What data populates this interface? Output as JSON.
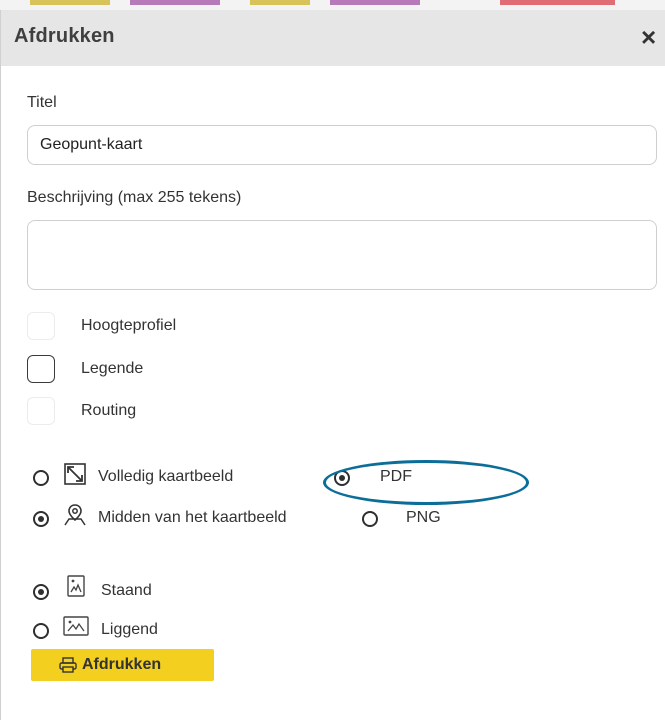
{
  "dialog": {
    "title": "Afdrukken",
    "close_glyph": "×"
  },
  "form": {
    "title_label": "Titel",
    "title_value": "Geopunt-kaart",
    "description_label": "Beschrijving (max 255 tekens)",
    "description_value": ""
  },
  "checkboxes": [
    {
      "label": "Hoogteprofiel",
      "checked": false
    },
    {
      "label": "Legende",
      "checked": false
    },
    {
      "label": "Routing",
      "checked": false
    }
  ],
  "extent_options": [
    {
      "label": "Volledig kaartbeeld",
      "icon": "full-extent-icon",
      "selected": false
    },
    {
      "label": "Midden van het kaartbeeld",
      "icon": "map-pin-icon",
      "selected": true
    }
  ],
  "format_options": [
    {
      "label": "PDF",
      "selected": true
    },
    {
      "label": "PNG",
      "selected": false
    }
  ],
  "orientation_options": [
    {
      "label": "Staand",
      "icon": "portrait-image-icon",
      "selected": true
    },
    {
      "label": "Liggend",
      "icon": "landscape-image-icon",
      "selected": false
    }
  ],
  "print_button": {
    "label": "Afdrukken",
    "icon": "printer-icon"
  },
  "colors": {
    "header_bg": "#e6e6e6",
    "button_bg": "#f3cf1f",
    "highlight": "#0c6d99"
  }
}
